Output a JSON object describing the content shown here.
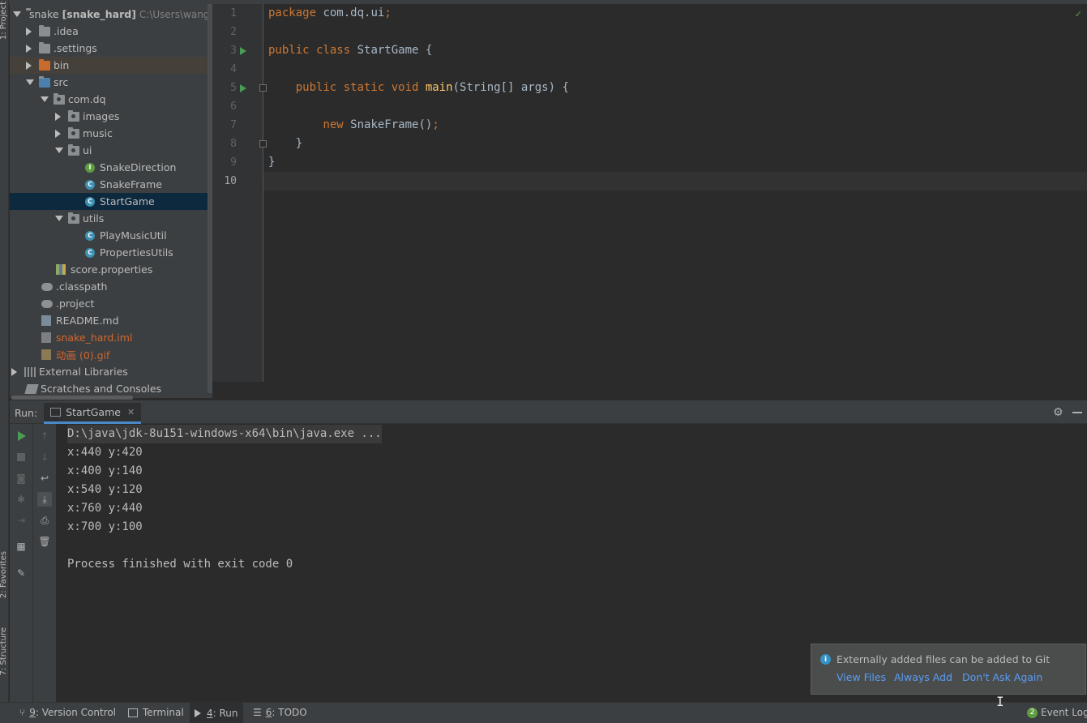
{
  "side_tabs": {
    "project": "1: Project",
    "favorites": "2: Favorites",
    "structure": "7: Structure"
  },
  "project_tree": {
    "root_name": "snake",
    "root_module": "[snake_hard]",
    "root_path": "C:\\Users\\wangs",
    "items": [
      {
        "label": ".idea"
      },
      {
        "label": ".settings"
      },
      {
        "label": "bin"
      },
      {
        "label": "src"
      },
      {
        "label": "com.dq"
      },
      {
        "label": "images"
      },
      {
        "label": "music"
      },
      {
        "label": "ui"
      },
      {
        "label": "SnakeDirection"
      },
      {
        "label": "SnakeFrame"
      },
      {
        "label": "StartGame"
      },
      {
        "label": "utils"
      },
      {
        "label": "PlayMusicUtil"
      },
      {
        "label": "PropertiesUtils"
      },
      {
        "label": "score.properties"
      },
      {
        "label": ".classpath"
      },
      {
        "label": ".project"
      },
      {
        "label": "README.md"
      },
      {
        "label": "snake_hard.iml"
      },
      {
        "label": "动画 (0).gif"
      },
      {
        "label": "External Libraries"
      },
      {
        "label": "Scratches and Consoles"
      }
    ]
  },
  "editor": {
    "line_numbers": [
      "1",
      "2",
      "3",
      "4",
      "5",
      "6",
      "7",
      "8",
      "9",
      "10"
    ],
    "code": {
      "l1_kw": "package",
      "l1_rest": " com.dq.ui",
      "l1_semi": ";",
      "l3_kw": "public class",
      "l3_rest": " StartGame {",
      "l5_kw": "public static void",
      "l5_fn": " main",
      "l5_rest": "(String[] args) {",
      "l7_kw": "new",
      "l7_rest": " SnakeFrame()",
      "l7_semi": ";",
      "l8": "}",
      "l9": "}"
    }
  },
  "run_panel": {
    "label": "Run:",
    "tab_title": "StartGame",
    "console_lines": [
      "D:\\java\\jdk-8u151-windows-x64\\bin\\java.exe ...",
      "x:440 y:420",
      "x:400 y:140",
      "x:540 y:120",
      "x:760 y:440",
      "x:700 y:100",
      "",
      "Process finished with exit code 0"
    ]
  },
  "notification": {
    "text": "Externally added files can be added to Git",
    "view_files": "View Files",
    "always_add": "Always Add",
    "dont_ask": "Don't Ask Again"
  },
  "status_bar": {
    "version_control_num": "9",
    "version_control": ": Version Control",
    "terminal": "Terminal",
    "run_num": "4",
    "run": ": Run",
    "todo_num": "6",
    "todo": ": TODO",
    "event_log_count": "2",
    "event_log": "Event Log"
  },
  "colors": {
    "background": "#2b2b2b",
    "panel": "#3c3f41",
    "keyword": "#cc7832",
    "function": "#ffc66d",
    "link": "#589df6",
    "run_green": "#499c54",
    "selection": "#0d293e"
  }
}
